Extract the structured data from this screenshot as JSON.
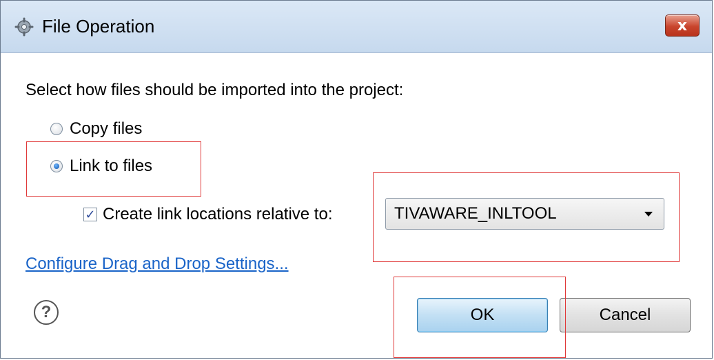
{
  "window": {
    "title": "File Operation",
    "close_label": "x",
    "icon": "gear-icon"
  },
  "dialog": {
    "prompt": "Select how files should be imported into the project:",
    "options": [
      {
        "label": "Copy files",
        "checked": false
      },
      {
        "label": "Link to files",
        "checked": true
      }
    ],
    "relative": {
      "label": "Create link locations relative to:",
      "checked": true,
      "selected_value": "TIVAWARE_INLTOOL"
    },
    "link_text": "Configure Drag and Drop Settings...",
    "help_icon": "help-icon",
    "help_glyph": "?"
  },
  "buttons": {
    "ok": "OK",
    "cancel": "Cancel"
  },
  "colors": {
    "highlight": "#e03a3a",
    "link": "#1a64c8",
    "close": "#c9452d"
  }
}
